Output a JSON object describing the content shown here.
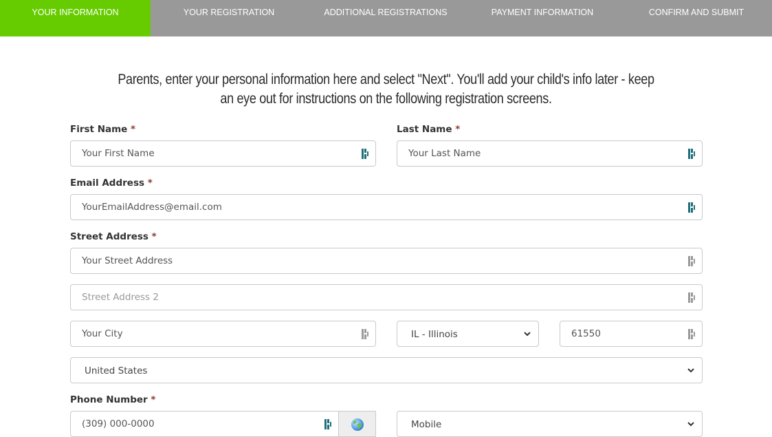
{
  "steps": [
    {
      "label": "YOUR INFORMATION",
      "active": true
    },
    {
      "label": "YOUR REGISTRATION",
      "active": false
    },
    {
      "label": "ADDITIONAL REGISTRATIONS",
      "active": false
    },
    {
      "label": "PAYMENT INFORMATION",
      "active": false
    },
    {
      "label": "CONFIRM AND SUBMIT",
      "active": false
    }
  ],
  "colors": {
    "active_step": "#66cc00",
    "inactive_step": "#999999",
    "required_asterisk": "#8b3a2b",
    "password_manager_icon": "#1e6f7a"
  },
  "intro_text": "Parents, enter your personal information here and select \"Next\". You'll add your child's info later - keep an eye out for instructions on the following registration screens.",
  "form": {
    "required_marker": "*",
    "first_name": {
      "label": "First Name",
      "value": "Your First Name"
    },
    "last_name": {
      "label": "Last Name",
      "value": "Your Last Name"
    },
    "email": {
      "label": "Email Address",
      "value": "YourEmailAddress@email.com"
    },
    "street": {
      "label": "Street Address",
      "value": "Your Street Address"
    },
    "street2": {
      "placeholder": "Street Address 2",
      "value": ""
    },
    "city": {
      "value": "Your City"
    },
    "state": {
      "selected": "IL - Illinois"
    },
    "zip": {
      "value": "61550"
    },
    "country": {
      "selected": "United States"
    },
    "phone": {
      "label": "Phone Number",
      "value": "(309) 000-0000"
    },
    "phone_type": {
      "selected": "Mobile"
    }
  },
  "icons": {
    "password_manager": "password-manager-icon",
    "globe": "globe-icon",
    "chevron": "chevron-down-icon"
  }
}
